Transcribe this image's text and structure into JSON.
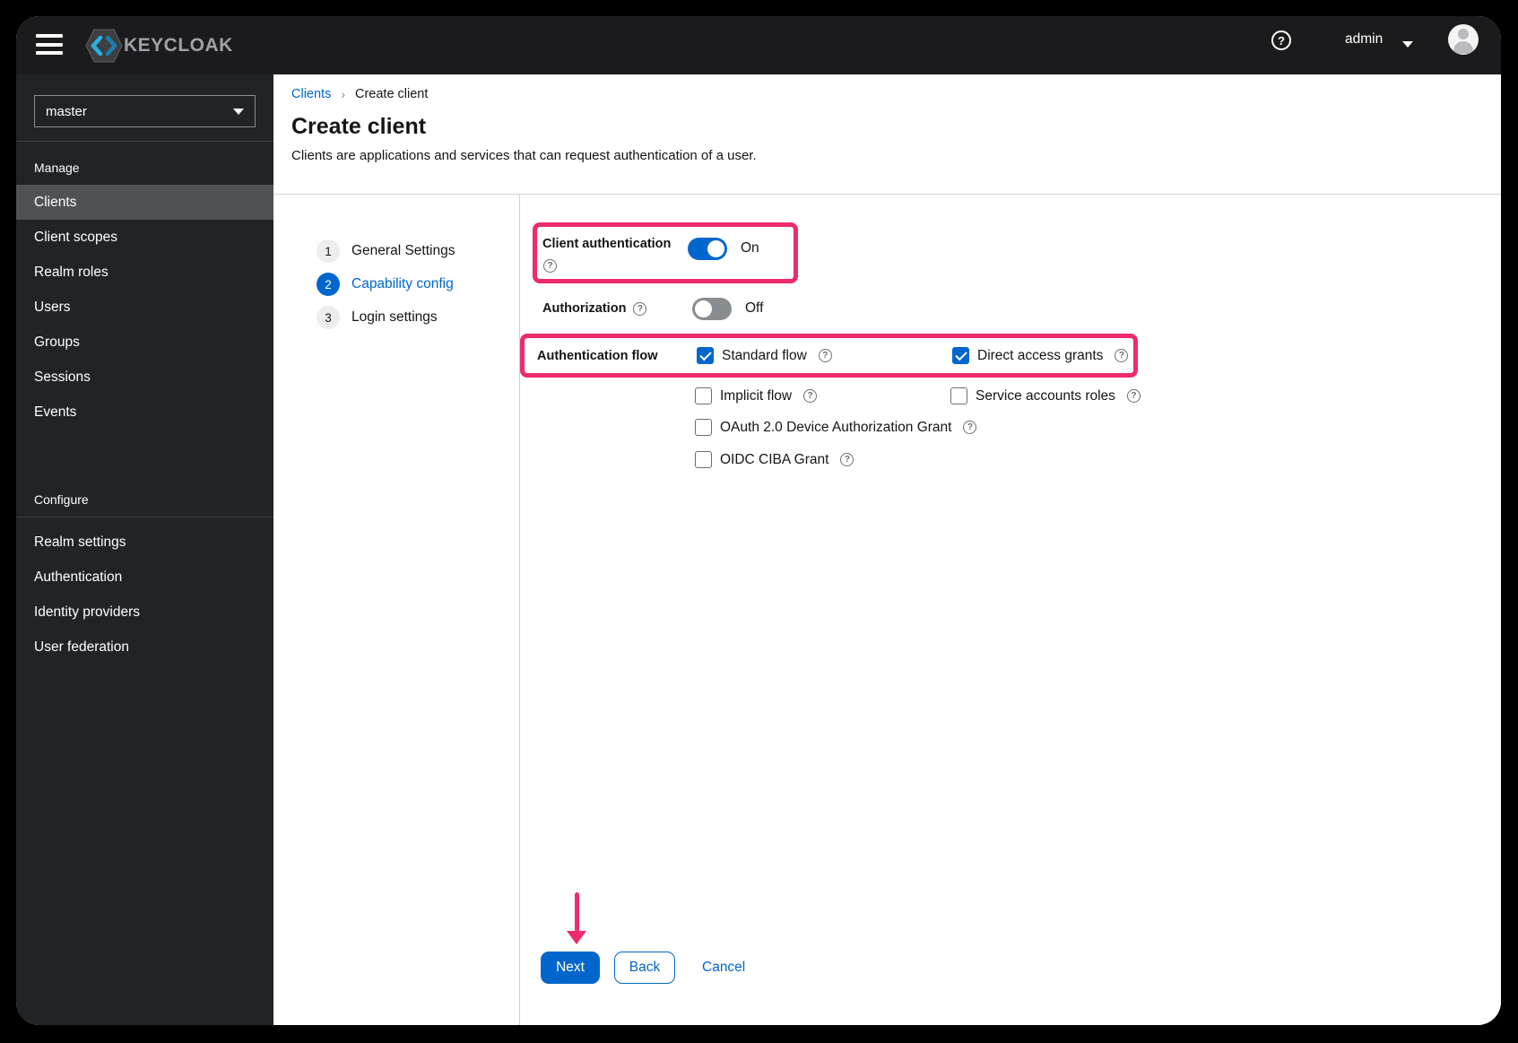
{
  "colors": {
    "accent": "#0066cc",
    "highlight_pink": "#ed2b6e",
    "masthead_bg": "#1b1b1d",
    "sidebar_bg": "#212427"
  },
  "masthead": {
    "brand": "KEYCLOAK",
    "help_icon": "question-circle-icon",
    "user_menu": {
      "label": "admin"
    },
    "avatar_icon": "user-avatar-icon"
  },
  "sidebar": {
    "realm_selector": {
      "value": "master"
    },
    "sections": [
      {
        "title": "Manage",
        "items": [
          {
            "label": "Clients",
            "selected": true
          },
          {
            "label": "Client scopes",
            "selected": false
          },
          {
            "label": "Realm roles",
            "selected": false
          },
          {
            "label": "Users",
            "selected": false
          },
          {
            "label": "Groups",
            "selected": false
          },
          {
            "label": "Sessions",
            "selected": false
          },
          {
            "label": "Events",
            "selected": false
          }
        ]
      },
      {
        "title": "Configure",
        "items": [
          {
            "label": "Realm settings",
            "selected": false
          },
          {
            "label": "Authentication",
            "selected": false
          },
          {
            "label": "Identity providers",
            "selected": false
          },
          {
            "label": "User federation",
            "selected": false
          }
        ]
      }
    ]
  },
  "breadcrumb": {
    "parent": "Clients",
    "separator": "›",
    "current": "Create client"
  },
  "page": {
    "title": "Create client",
    "subtitle": "Clients are applications and services that can request authentication of a user."
  },
  "wizard": {
    "steps": [
      {
        "number": "1",
        "label": "General Settings",
        "active": false
      },
      {
        "number": "2",
        "label": "Capability config",
        "active": true
      },
      {
        "number": "3",
        "label": "Login settings",
        "active": false
      }
    ],
    "form": {
      "client_authentication": {
        "label": "Client authentication",
        "state": "On",
        "enabled": true
      },
      "authorization": {
        "label": "Authorization",
        "state": "Off",
        "enabled": false
      },
      "authentication_flow": {
        "label": "Authentication flow",
        "options": [
          {
            "label": "Standard flow",
            "checked": true
          },
          {
            "label": "Direct access grants",
            "checked": true
          },
          {
            "label": "Implicit flow",
            "checked": false
          },
          {
            "label": "Service accounts roles",
            "checked": false
          },
          {
            "label": "OAuth 2.0 Device Authorization Grant",
            "checked": false
          },
          {
            "label": "OIDC CIBA Grant",
            "checked": false
          }
        ]
      }
    },
    "footer": {
      "next": "Next",
      "back": "Back",
      "cancel": "Cancel"
    }
  }
}
